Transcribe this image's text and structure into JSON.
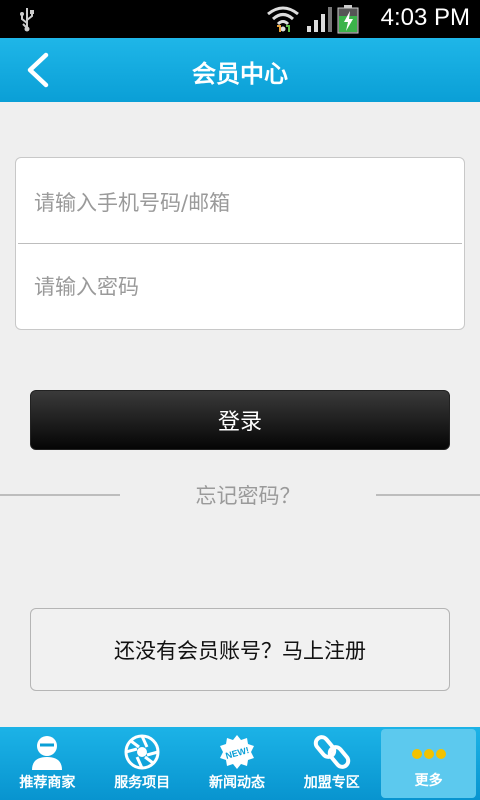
{
  "status_bar": {
    "time": "4:03 PM"
  },
  "header": {
    "title": "会员中心"
  },
  "login_form": {
    "account_placeholder": "请输入手机号码/邮箱",
    "password_placeholder": "请输入密码"
  },
  "login_button": "登录",
  "forgot_password": "忘记密码？",
  "register_button": "还没有会员账号？马上注册",
  "tab_bar": {
    "tabs": [
      {
        "label": "推荐商家",
        "icon": "user-icon"
      },
      {
        "label": "服务项目",
        "icon": "camera-shutter-icon"
      },
      {
        "label": "新闻动态",
        "icon": "new-badge-icon"
      },
      {
        "label": "加盟专区",
        "icon": "link-icon"
      },
      {
        "label": "更多",
        "icon": "more-dots-icon"
      }
    ],
    "active_index": 4
  },
  "colors": {
    "accent": "#0fa8df",
    "active_tab": "#5cc9ee"
  }
}
